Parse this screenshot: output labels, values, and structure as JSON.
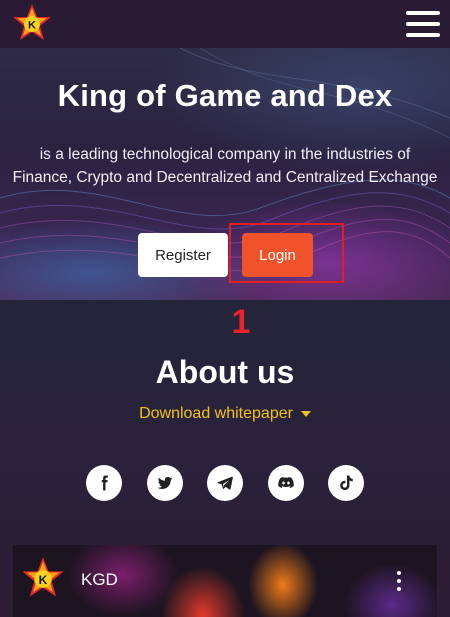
{
  "header": {
    "logo_icon": "kgd-star-logo-icon",
    "menu_icon": "hamburger-menu-icon"
  },
  "hero": {
    "title": "King of Game and Dex",
    "subtitle": "is a leading technological company in the industries of Finance, Crypto and Decentralized and Centralized Exchange",
    "register_label": "Register",
    "login_label": "Login"
  },
  "annotation": {
    "step_number": "1",
    "highlight_color": "#e02020"
  },
  "about": {
    "title": "About us",
    "whitepaper_label": "Download whitepaper"
  },
  "social": [
    {
      "icon": "facebook-icon"
    },
    {
      "icon": "twitter-icon"
    },
    {
      "icon": "telegram-icon"
    },
    {
      "icon": "discord-icon"
    },
    {
      "icon": "tiktok-icon"
    }
  ],
  "video": {
    "title": "KGD",
    "menu_icon": "more-vertical-icon"
  },
  "colors": {
    "accent": "#f0522b",
    "link": "#f3c21a",
    "background": "#231a33"
  }
}
